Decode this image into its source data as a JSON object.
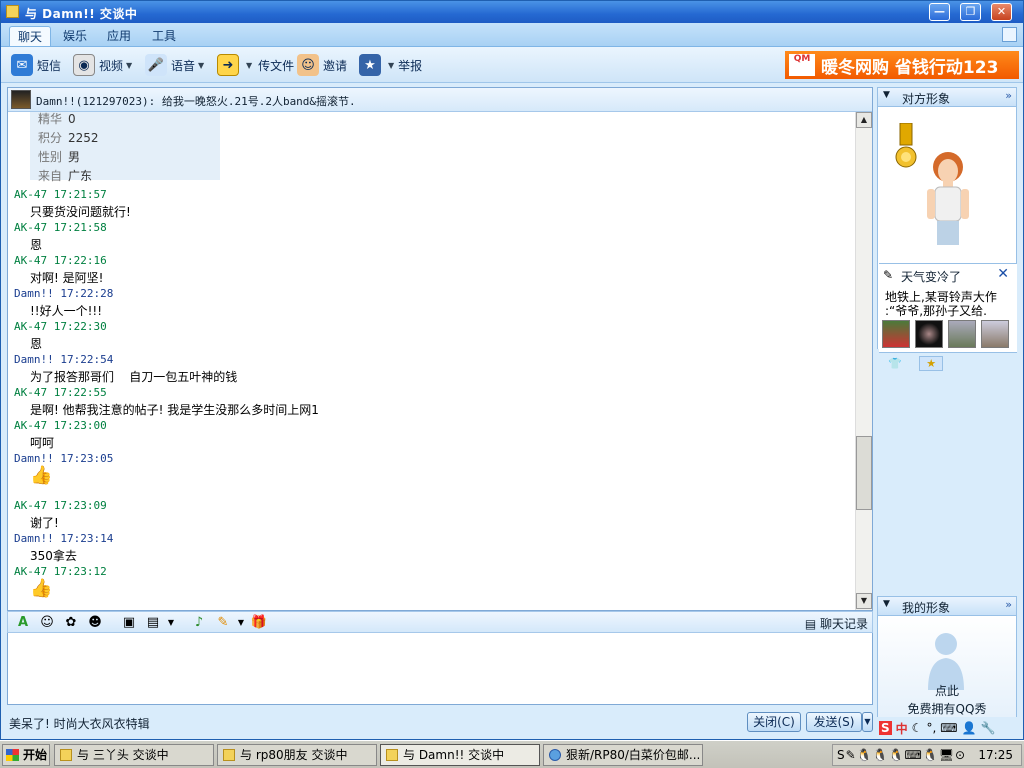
{
  "window": {
    "title": "与 Damn!! 交谈中",
    "buttons": {
      "minimize": "—",
      "maximize": "❐",
      "close": "✕"
    }
  },
  "menu": {
    "tabs": [
      "聊天",
      "娱乐",
      "应用",
      "工具"
    ],
    "active": "聊天"
  },
  "toolbar": {
    "sms": "短信",
    "video": "视频",
    "voice": "语音",
    "send_file": "传文件",
    "invite": "邀请",
    "report": "举报",
    "banner_text": "暖冬网购 省钱行动123",
    "banner_logo": "QM"
  },
  "chat": {
    "header": "Damn!!(121297023): 给我一晚怒火.21号.2人band&摇滚节.",
    "profile": [
      {
        "key": "精华",
        "value": "0"
      },
      {
        "key": "积分",
        "value": "2252"
      },
      {
        "key": "性别",
        "value": "男"
      },
      {
        "key": "来自",
        "value": "广东"
      }
    ],
    "messages": [
      {
        "head": "AK-47 17:21:57",
        "body": "只要货没问题就行!"
      },
      {
        "head": "AK-47 17:21:58",
        "body": "恩"
      },
      {
        "head": "AK-47 17:22:16",
        "body": "对啊! 是阿坚!"
      },
      {
        "head": "Damn!! 17:22:28",
        "body": "!!好人一个!!!"
      },
      {
        "head": "AK-47 17:22:30",
        "body": "恩"
      },
      {
        "head": "Damn!! 17:22:54",
        "body": "为了报答那哥们    自刀一包五叶神的钱"
      },
      {
        "head": "AK-47 17:22:55",
        "body": "是啊! 他帮我注意的帖子! 我是学生没那么多时间上网1"
      },
      {
        "head": "AK-47 17:23:00",
        "body": "呵呵"
      },
      {
        "head": "Damn!! 17:23:05",
        "body": ""
      },
      {
        "head": "AK-47 17:23:09",
        "body": "谢了!"
      },
      {
        "head": "Damn!! 17:23:14",
        "body": "350拿去"
      },
      {
        "head": "AK-47 17:23:12",
        "body": ""
      }
    ]
  },
  "input": {
    "history_label": "聊天记录"
  },
  "footer": {
    "status_text": "美呆了! 时尚大衣风衣特辑",
    "close_button": "关闭(C)",
    "send_button": "发送(S)"
  },
  "right": {
    "their_image": "对方形象",
    "my_image": "我的形象",
    "weather_title": "天气变冷了",
    "weather_line1": "地铁上,某哥铃声大作",
    "weather_line2": ":“爷爷,那孙子又给.",
    "click_text": "点此",
    "free_text": "免费拥有QQ秀"
  },
  "taskbar": {
    "start": "开始",
    "items": [
      "与 三丫头 交谈中",
      "与 rp80朋友 交谈中",
      "与 Damn!! 交谈中",
      "狠新/RP80/白菜价包邮..."
    ],
    "clock": "17:25"
  }
}
